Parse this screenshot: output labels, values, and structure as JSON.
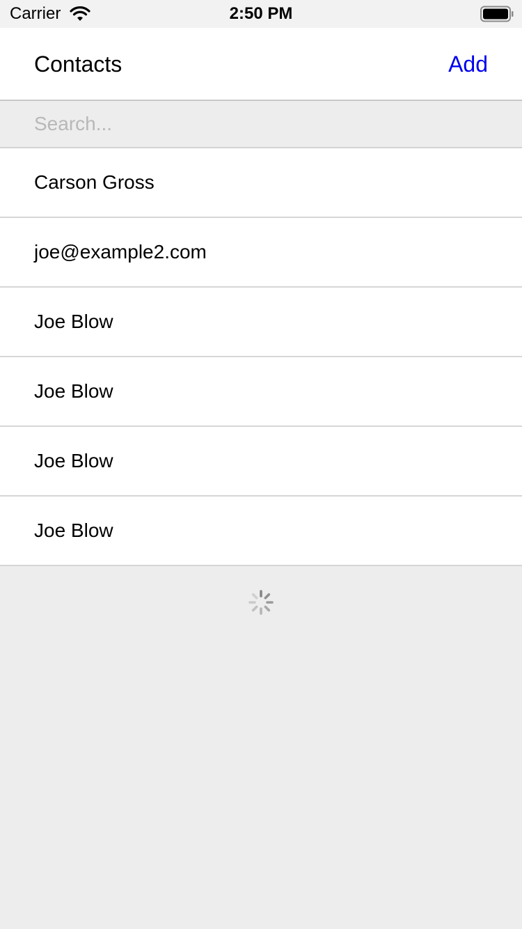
{
  "status_bar": {
    "carrier": "Carrier",
    "time": "2:50 PM",
    "icons": [
      "wifi-icon",
      "battery-icon"
    ]
  },
  "header": {
    "title": "Contacts",
    "add_label": "Add",
    "accent_color": "#0000ee"
  },
  "search": {
    "placeholder": "Search...",
    "value": ""
  },
  "contacts": [
    {
      "label": "Carson Gross"
    },
    {
      "label": "joe@example2.com"
    },
    {
      "label": "Joe Blow"
    },
    {
      "label": "Joe Blow"
    },
    {
      "label": "Joe Blow"
    },
    {
      "label": "Joe Blow"
    }
  ],
  "loading_indicator": "spinner-icon"
}
